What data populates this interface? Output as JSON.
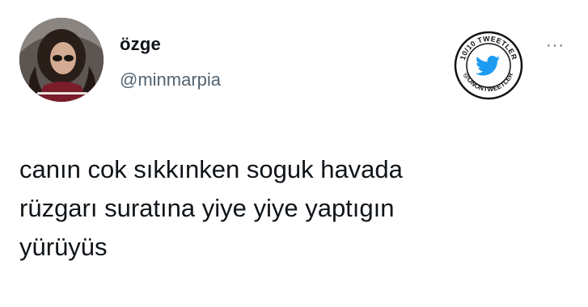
{
  "tweet": {
    "author": {
      "display_name": "özge",
      "handle": "@minmarpia"
    },
    "text": "canın cok sıkkınken soguk havada\nrüzgarı suratına yiye yiye yaptıgın\nyürüyüs",
    "more_icon": "more-horizontal-icon"
  },
  "badge": {
    "top_text": "10/10 TWEETLER",
    "bottom_text": "@ONONTWEETLER",
    "icon": "twitter-bird-icon",
    "colors": {
      "ring": "#111111",
      "bird": "#1d9bf0"
    }
  }
}
